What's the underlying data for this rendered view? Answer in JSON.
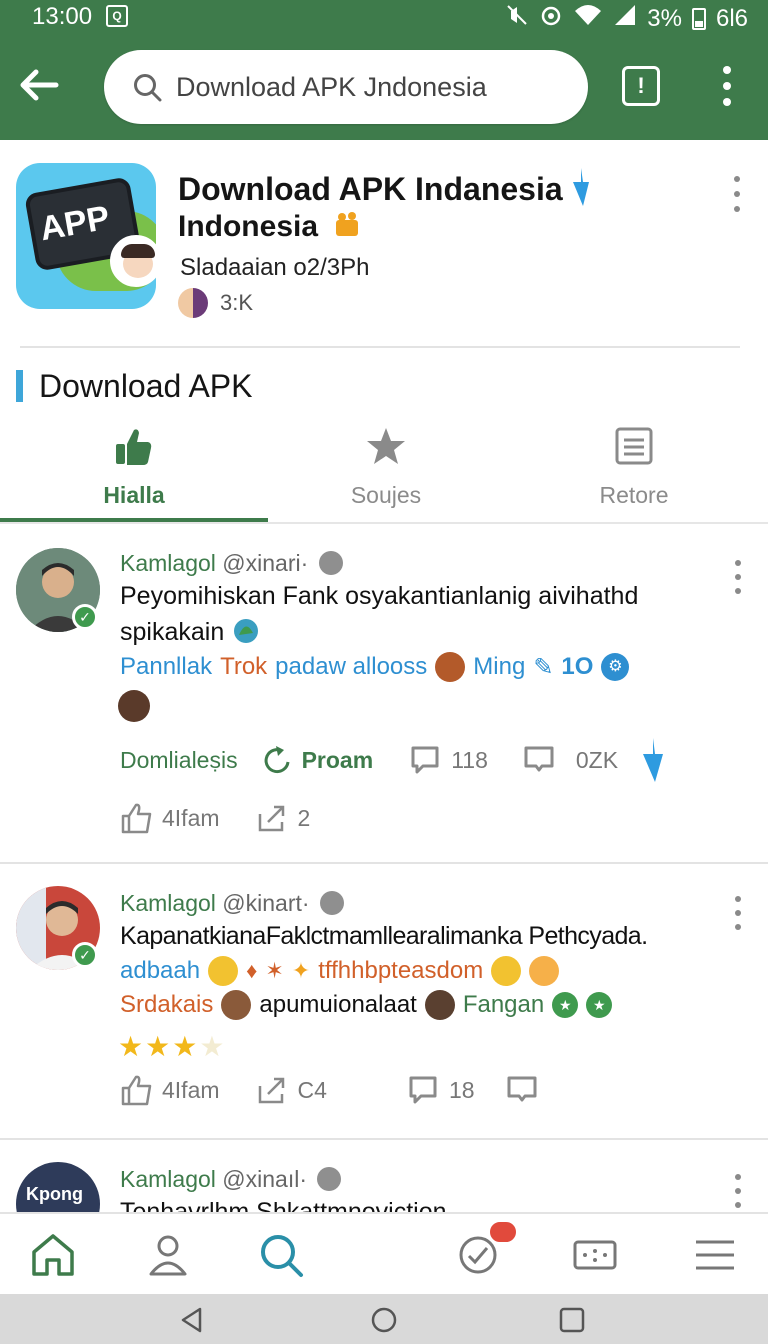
{
  "status_bar": {
    "time": "13:00",
    "sim_label": "Q",
    "battery_text": "3%",
    "signal_text": "6l6"
  },
  "app_bar": {
    "search_value": "Download APK Jndonesia",
    "icons": [
      "back-arrow-icon",
      "search-icon",
      "download-icon",
      "more-vert-icon"
    ]
  },
  "app": {
    "title_line1": "Download APK Indanesia",
    "title_line2": "Indonesia",
    "icon_text": "APP",
    "subtitle": "Sladaaian o2/3Ph",
    "followers": "3:K"
  },
  "section": {
    "title": "Download APK"
  },
  "tabs": [
    {
      "label": "Hialla",
      "icon": "thumbs-up-icon",
      "active": true
    },
    {
      "label": "Soujes",
      "icon": "star-icon",
      "active": false
    },
    {
      "label": "Retore",
      "icon": "list-icon",
      "active": false
    }
  ],
  "posts": [
    {
      "author": "Kamlagol",
      "handle": "@xinari·",
      "body": "Peyomihiskan Fank osyakantianlanig aivihathd spikakain",
      "tags": [
        "Pannllak",
        "Trok",
        "padaw allooss",
        "Ming",
        "1O"
      ],
      "actions": {
        "label1": "Domlialeṣis",
        "label2": "Proam",
        "comments": "118",
        "downloads": "0ΖK"
      },
      "likes": "4Ifam",
      "shares": "2"
    },
    {
      "author": "Kamlagol",
      "handle": "@kinart·",
      "body": "KapanatkianaFaklctmamllearalimanka Pethcyada.",
      "tags_line1": [
        "adbaah",
        "tffhhbpteasdom"
      ],
      "tags_line2": [
        "Srdakais",
        "apumuionalaat",
        "Fangan"
      ],
      "rating": 3,
      "likes": "4Ifam",
      "shares": "C4",
      "comments": "18"
    },
    {
      "author": "Kamlagol",
      "handle": "@xinaıl·",
      "avatar_text": "Kpong",
      "body": "Tenhavrlhm Shkattmnoviction"
    }
  ],
  "bottom_nav": [
    "home-icon",
    "profile-icon",
    "search-icon",
    "messages-icon",
    "tickets-icon",
    "menu-icon"
  ],
  "colors": {
    "brand_green": "#3e7b4b",
    "accent_blue": "#2e8fd1",
    "accent_orange": "#d1602a"
  }
}
